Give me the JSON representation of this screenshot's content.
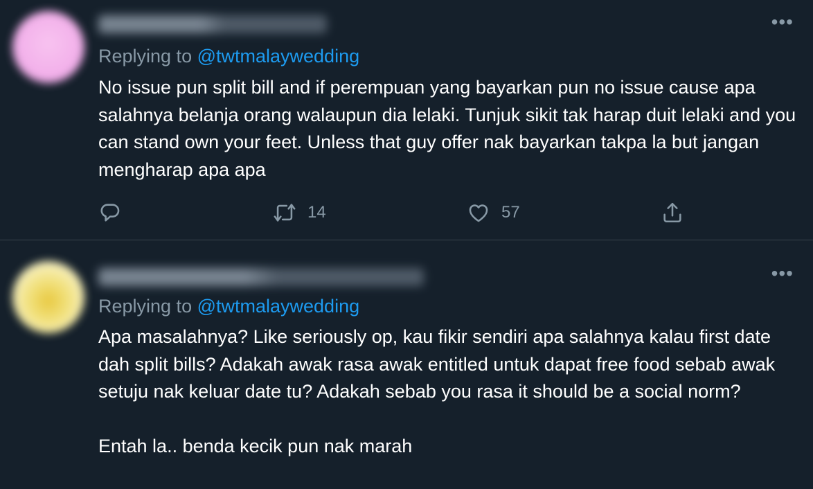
{
  "tweets": [
    {
      "replying_prefix": "Replying to ",
      "replying_handle": "@twtmalaywedding",
      "text": "No issue pun split bill and if perempuan yang bayarkan pun no issue cause apa salahnya belanja orang walaupun dia lelaki. Tunjuk sikit tak harap duit lelaki and you can stand own your feet. Unless that guy offer nak bayarkan takpa la but jangan mengharap apa apa",
      "retweets": "14",
      "likes": "57"
    },
    {
      "replying_prefix": "Replying to ",
      "replying_handle": "@twtmalaywedding",
      "text": "Apa masalahnya? Like seriously op, kau fikir sendiri apa salahnya kalau first date dah split bills? Adakah awak rasa awak entitled untuk dapat free food sebab awak setuju nak keluar date tu? Adakah sebab you rasa it should be a social norm?\n\nEntah la.. benda kecik pun nak marah"
    }
  ],
  "more_glyph": "•••",
  "colors": {
    "background": "#15202b",
    "accent": "#1d9bf0",
    "muted": "#8899a6",
    "divider": "#38444d"
  },
  "icons": [
    "reply-icon",
    "retweet-icon",
    "like-icon",
    "share-icon",
    "more-icon"
  ]
}
